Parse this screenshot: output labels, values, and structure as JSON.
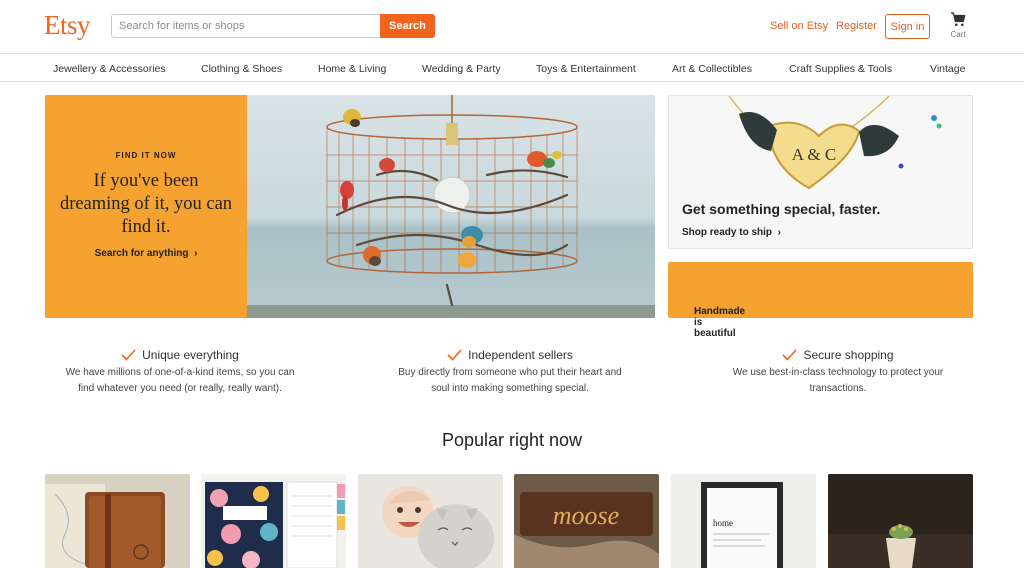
{
  "header": {
    "logo": "Etsy",
    "search_placeholder": "Search for items or shops",
    "search_button": "Search",
    "sell_link": "Sell on Etsy",
    "register_link": "Register",
    "signin_button": "Sign in",
    "cart_label": "Cart"
  },
  "nav": {
    "items": [
      "Jewellery & Accessories",
      "Clothing & Shoes",
      "Home & Living",
      "Wedding & Party",
      "Toys & Entertainment",
      "Art & Collectibles",
      "Craft Supplies & Tools",
      "Vintage"
    ]
  },
  "hero": {
    "eyebrow": "FIND IT NOW",
    "headline": "If you've been dreaming of it, you can find it.",
    "cta": "Search for anything",
    "chevron": "›"
  },
  "promo": {
    "title": "Get something special, faster.",
    "link": "Shop ready to ship",
    "handmade": "Handmade is beautiful",
    "necklace_letters": "A & C"
  },
  "value_props": [
    {
      "title": "Unique everything",
      "body": "We have millions of one-of-a-kind items, so you can find whatever you need (or really, really want)."
    },
    {
      "title": "Independent sellers",
      "body": "Buy directly from someone who put their heart and soul into making something special."
    },
    {
      "title": "Secure shopping",
      "body": "We use best-in-class technology to protect your transactions."
    }
  ],
  "popular": {
    "title": "Popular right now",
    "keyring_text": "moose",
    "print_word": "home"
  },
  "colors": {
    "brand": "#f1641e",
    "accent_orange": "#f5a231"
  }
}
